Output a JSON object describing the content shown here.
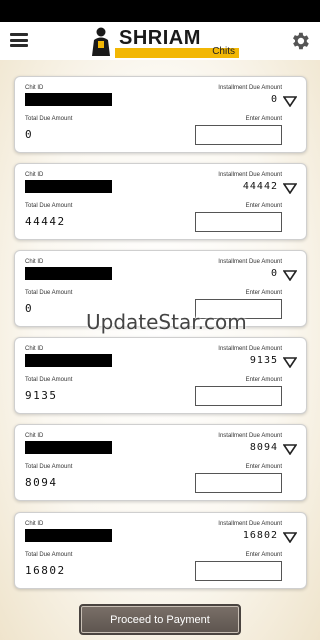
{
  "header": {
    "brand_name": "SHRIAM",
    "brand_sub": "Chits",
    "brand_color": "#f2b705",
    "menu_icon": "hamburger-menu-icon",
    "settings_icon": "gear-icon"
  },
  "labels": {
    "chit_id": "Chit ID",
    "installment_due": "Installment Due Amount",
    "total_due": "Total Due Amount",
    "enter_amount": "Enter Amount"
  },
  "cards": [
    {
      "installment_due": "0",
      "total_due": "0"
    },
    {
      "installment_due": "44442",
      "total_due": "44442"
    },
    {
      "installment_due": "0",
      "total_due": "0"
    },
    {
      "installment_due": "9135",
      "total_due": "9135"
    },
    {
      "installment_due": "8094",
      "total_due": "8094"
    },
    {
      "installment_due": "16802",
      "total_due": "16802"
    }
  ],
  "watermark": "UpdateStar.com",
  "actions": {
    "proceed_label": "Proceed to Payment"
  }
}
